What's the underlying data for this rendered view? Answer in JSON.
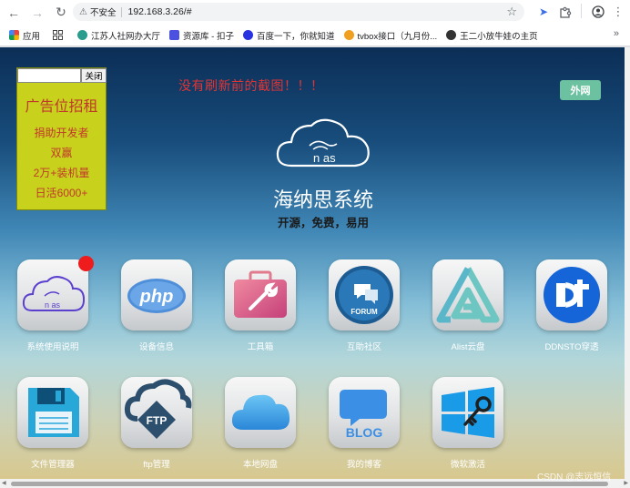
{
  "browser": {
    "security_label": "不安全",
    "url": "192.168.3.26/#",
    "bookmarks": [
      {
        "label": "应用",
        "color": "#e8453c"
      },
      {
        "label": "江苏人社网办大厅",
        "color": "#2a9d8f"
      },
      {
        "label": "资源库 - 扣子",
        "color": "#4c51e0"
      },
      {
        "label": "百度一下，你就知道",
        "color": "#2932e1"
      },
      {
        "label": "tvbox接口（九月份...",
        "color": "#f0a020"
      },
      {
        "label": "王二小放牛娃の主页",
        "color": "#333333"
      }
    ],
    "more_bookmarks": "»"
  },
  "ad": {
    "close_label": "关闭",
    "title": "广告位招租",
    "lines": [
      "捐助开发者",
      "双赢",
      "2万+装机量",
      "日活6000+"
    ]
  },
  "notice": "没有刷新前的截图！！！",
  "external_button": "外网",
  "system": {
    "name": "海纳思系统",
    "subtitle": "开源，免费，易用"
  },
  "apps_row1": [
    {
      "label": "系统使用说明",
      "icon": "nas-cloud-icon"
    },
    {
      "label": "设备信息",
      "icon": "php-icon"
    },
    {
      "label": "工具箱",
      "icon": "toolbox-icon"
    },
    {
      "label": "互助社区",
      "icon": "forum-icon"
    },
    {
      "label": "Alist云盘",
      "icon": "alist-icon"
    },
    {
      "label": "DDNSTO穿透",
      "icon": "ddnsto-icon"
    }
  ],
  "apps_row2": [
    {
      "label": "文件管理器",
      "icon": "floppy-icon"
    },
    {
      "label": "ftp管理",
      "icon": "ftp-icon"
    },
    {
      "label": "本地网盘",
      "icon": "cloud-icon"
    },
    {
      "label": "我的博客",
      "icon": "blog-icon"
    },
    {
      "label": "微软激活",
      "icon": "windows-key-icon"
    }
  ],
  "forum_text": "FORUM",
  "ftp_text": "FTP",
  "blog_text": "BLOG",
  "logo_text": "n as",
  "watermark": "CSDN @志远恒信"
}
